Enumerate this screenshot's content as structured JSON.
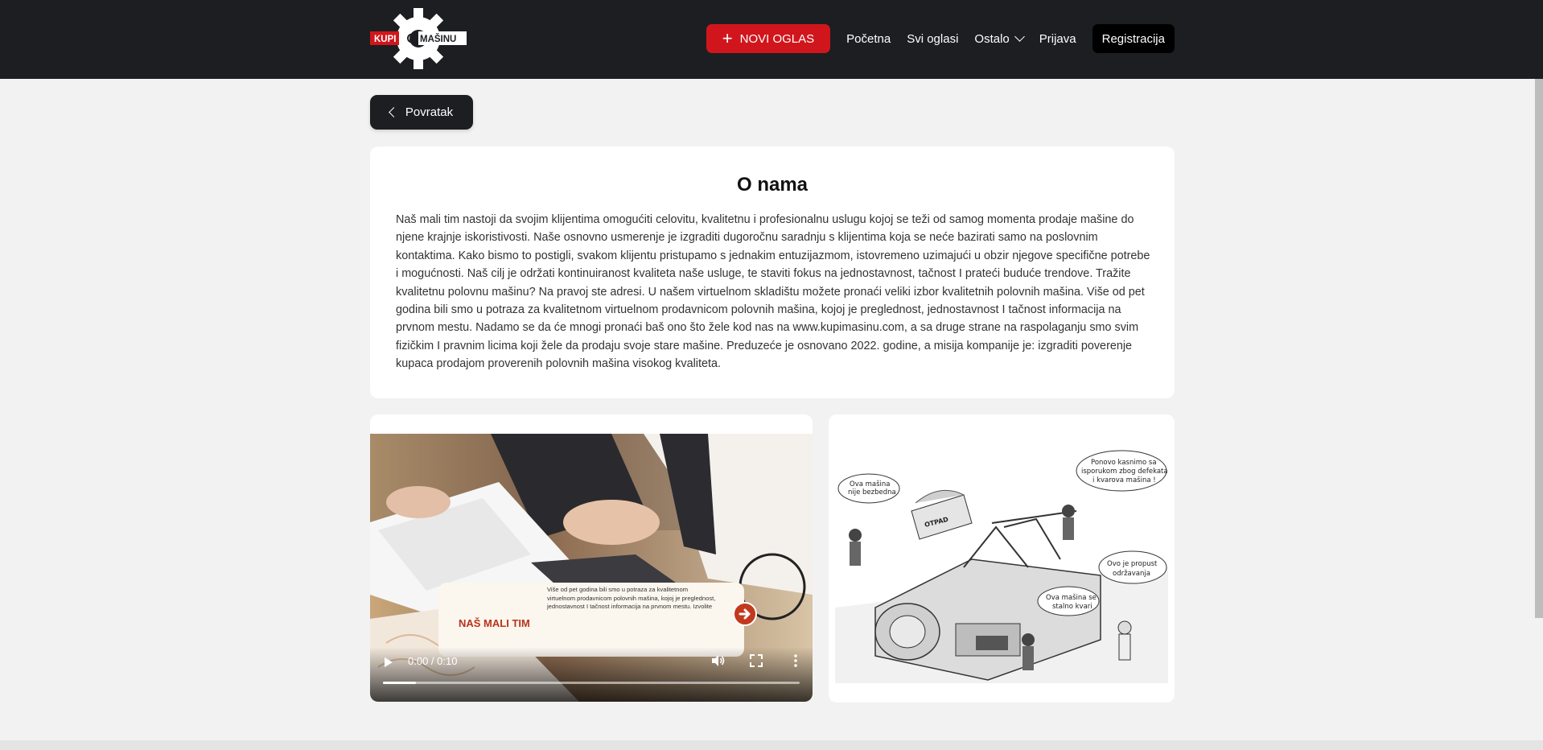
{
  "header": {
    "logo_text_left": "KUPI",
    "logo_text_right": "MAŠINU",
    "new_ad_label": "NOVI OGLAS",
    "nav": [
      {
        "label": "Početna"
      },
      {
        "label": "Svi oglasi"
      },
      {
        "label": "Ostalo"
      },
      {
        "label": "Prijava"
      }
    ],
    "register_label": "Registracija"
  },
  "back_label": "Povratak",
  "about": {
    "title": "O nama",
    "body": "Naš mali tim nastoji da svojim klijentima omogućiti celovitu, kvalitetnu i profesionalnu uslugu kojoj se teži od samog momenta prodaje mašine do njene krajnje iskoristivosti. Naše osnovno usmerenje je izgraditi dugoročnu saradnju s klijentima koja se neće bazirati samo na poslovnim kontaktima. Kako bismo to postigli, svakom klijentu pristupamo s jednakim entuzijazmom, istovremeno uzimajući u obzir njegove specifične potrebe i mogućnosti. Naš cilj je održati kontinuiranost kvaliteta naše usluge, te staviti fokus na jednostavnost, tačnost I prateći buduće trendove. Tražite kvalitetnu polovnu mašinu? Na pravoj ste adresi. U našem virtuelnom skladištu možete pronaći veliki izbor kvalitetnih polovnih mašina. Više od pet godina bili smo u potraza za kvalitetnom virtuelnom prodavnicom polovnih mašina, kojoj je preglednost, jednostavnost I tačnost informacija na prvnom mestu. Nadamo se da će mnogi pronaći baš ono što žele kod nas na www.kupimasinu.com, a sa druge strane na raspolaganju smo svim fizičkim I pravnim licima koji žele da prodaju svoje stare mašine. Preduzeće je osnovano 2022. godine, a misija kompanije je: izgraditi poverenje kupaca prodajom proverenih polovnih mašina visokog kvaliteta."
  },
  "video": {
    "overlay_title": "NAŠ MALI TIM",
    "overlay_text": "Više od pet godina bili smo u potraza za kvalitetnom virtuelnom prodavnicom polovnih mašina, kojoj je preglednost, jednostavnost I tačnost informacija na prvnom mestu. Izvolite",
    "time": "0:00 / 0:10",
    "progress": 0.08
  },
  "cartoon": {
    "bubble_1": [
      "Ova mašina",
      "nije bezbedna"
    ],
    "bubble_2": [
      "Ponovo kasnimo sa",
      "isporukom zbog defekata",
      "i kvarova mašina !"
    ],
    "bubble_3": [
      "Ovo je propust",
      "održavanja"
    ],
    "bubble_4": [
      "Ova mašina se",
      "stalno kvari"
    ],
    "sign": "OTPAD"
  },
  "colors": {
    "brand_red": "#d0161c",
    "header_bg": "#1c1e21",
    "page_bg": "#f2f2f2"
  }
}
